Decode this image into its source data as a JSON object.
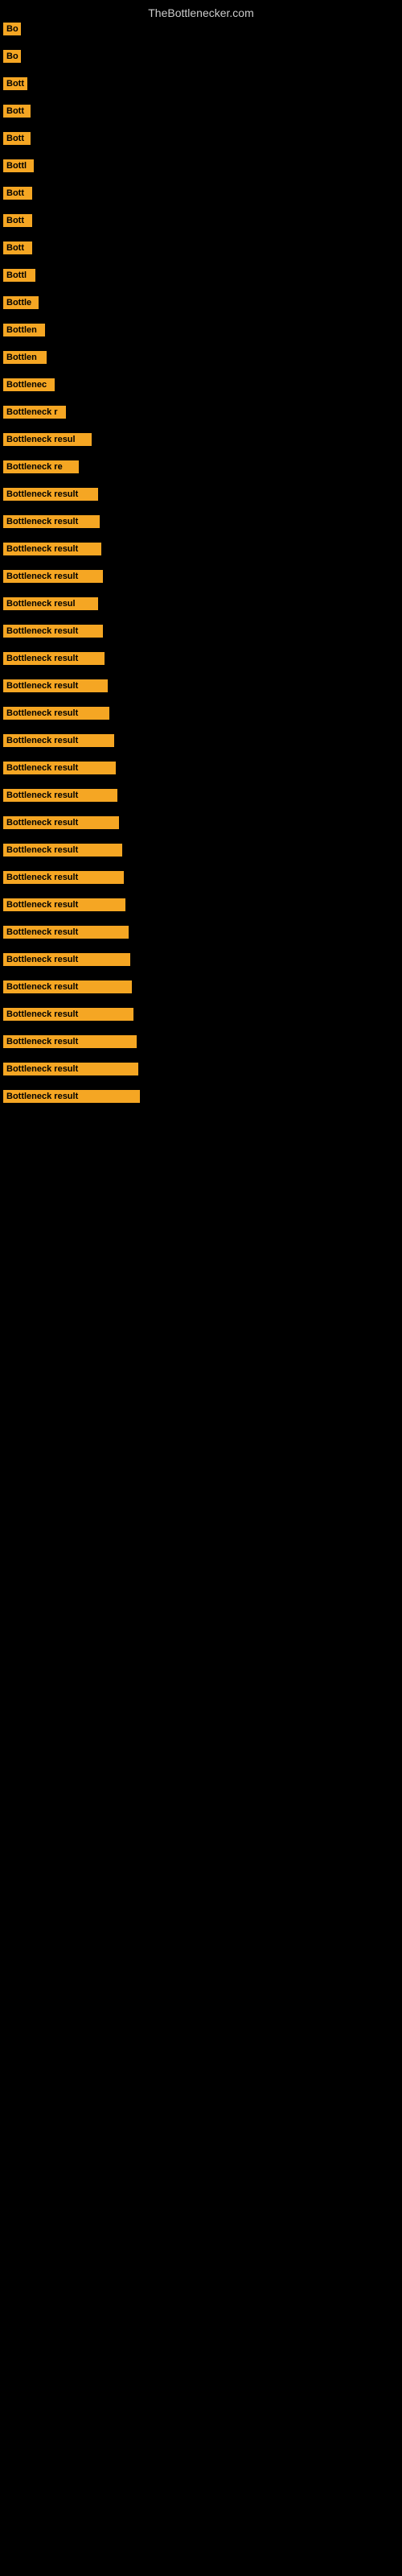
{
  "site": {
    "title": "TheBottlenecker.com"
  },
  "bars": [
    {
      "label": "Bo",
      "width": 22
    },
    {
      "label": "Bo",
      "width": 22
    },
    {
      "label": "Bott",
      "width": 30
    },
    {
      "label": "Bott",
      "width": 34
    },
    {
      "label": "Bott",
      "width": 34
    },
    {
      "label": "Bottl",
      "width": 38
    },
    {
      "label": "Bott",
      "width": 36
    },
    {
      "label": "Bott",
      "width": 36
    },
    {
      "label": "Bott",
      "width": 36
    },
    {
      "label": "Bottl",
      "width": 40
    },
    {
      "label": "Bottle",
      "width": 44
    },
    {
      "label": "Bottlen",
      "width": 52
    },
    {
      "label": "Bottlen",
      "width": 54
    },
    {
      "label": "Bottlenec",
      "width": 64
    },
    {
      "label": "Bottleneck r",
      "width": 78
    },
    {
      "label": "Bottleneck resul",
      "width": 110
    },
    {
      "label": "Bottleneck re",
      "width": 94
    },
    {
      "label": "Bottleneck result",
      "width": 118
    },
    {
      "label": "Bottleneck result",
      "width": 120
    },
    {
      "label": "Bottleneck result",
      "width": 122
    },
    {
      "label": "Bottleneck result",
      "width": 124
    },
    {
      "label": "Bottleneck resul",
      "width": 118
    },
    {
      "label": "Bottleneck result",
      "width": 124
    },
    {
      "label": "Bottleneck result",
      "width": 126
    },
    {
      "label": "Bottleneck result",
      "width": 130
    },
    {
      "label": "Bottleneck result",
      "width": 132
    },
    {
      "label": "Bottleneck result",
      "width": 138
    },
    {
      "label": "Bottleneck result",
      "width": 140
    },
    {
      "label": "Bottleneck result",
      "width": 142
    },
    {
      "label": "Bottleneck result",
      "width": 144
    },
    {
      "label": "Bottleneck result",
      "width": 148
    },
    {
      "label": "Bottleneck result",
      "width": 150
    },
    {
      "label": "Bottleneck result",
      "width": 152
    },
    {
      "label": "Bottleneck result",
      "width": 156
    },
    {
      "label": "Bottleneck result",
      "width": 158
    },
    {
      "label": "Bottleneck result",
      "width": 160
    },
    {
      "label": "Bottleneck result",
      "width": 162
    },
    {
      "label": "Bottleneck result",
      "width": 166
    },
    {
      "label": "Bottleneck result",
      "width": 168
    },
    {
      "label": "Bottleneck result",
      "width": 170
    }
  ]
}
